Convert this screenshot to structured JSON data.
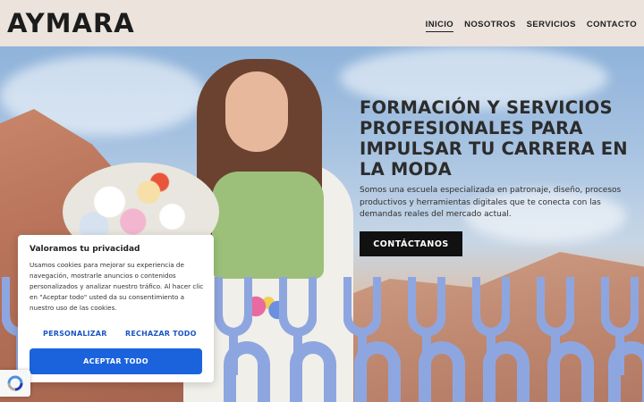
{
  "header": {
    "logo": "AYMARA",
    "nav": [
      {
        "label": "INICIO",
        "active": true
      },
      {
        "label": "NOSOTROS",
        "active": false
      },
      {
        "label": "SERVICIOS",
        "active": false
      },
      {
        "label": "CONTACTO",
        "active": false
      }
    ]
  },
  "hero": {
    "title": "FORMACIÓN Y SERVICIOS PROFESIONALES PARA IMPULSAR TU CARRERA EN LA MODA",
    "description": "Somos una escuela especializada en patronaje, diseño, procesos productivos y herramientas digitales que te conecta con las demandas reales del mercado actual.",
    "cta_label": "CONTÁCTANOS"
  },
  "cookie": {
    "title": "Valoramos tu privacidad",
    "text": "Usamos cookies para mejorar su experiencia de navegación, mostrarle anuncios o contenidos personalizados y analizar nuestro tráfico. Al hacer clic en \"Aceptar todo\" usted da su consentimiento a nuestro uso de las cookies.",
    "customize_label": "PERSONALIZAR",
    "reject_label": "RECHAZAR TODO",
    "accept_label": "ACEPTAR TODO"
  },
  "colors": {
    "header_bg": "#ebe3dc",
    "pattern_blue": "#8ea6e0",
    "cta_bg": "#111111",
    "accept_blue": "#1a63dc",
    "link_blue": "#1a56c4"
  },
  "icons": {
    "recaptcha": "recaptcha-icon"
  }
}
